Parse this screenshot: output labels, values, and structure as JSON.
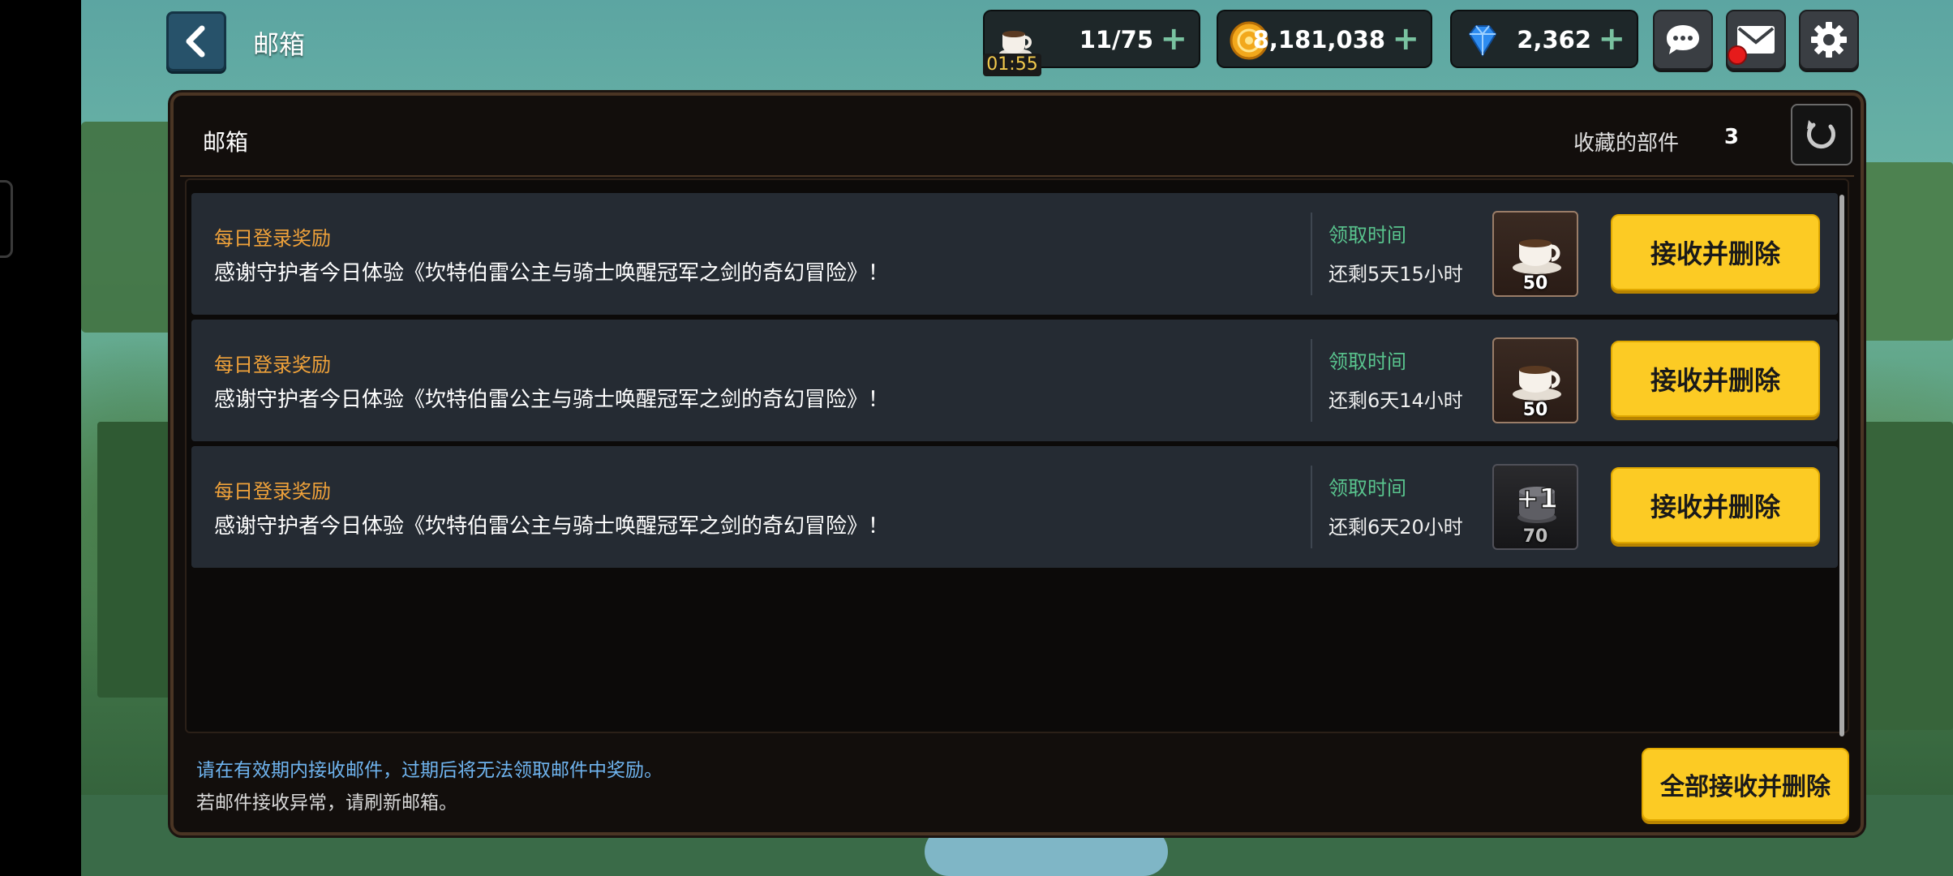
{
  "topbar": {
    "title": "邮箱",
    "stamina": {
      "value": "11/75",
      "timer": "01:55",
      "icon": "coffee-cup-icon"
    },
    "gold": {
      "value": "8,181,038",
      "icon": "gold-coin-icon"
    },
    "gems": {
      "value": "2,362",
      "icon": "diamond-icon"
    },
    "add_symbol": "+"
  },
  "panel": {
    "title": "邮箱",
    "favorites_label": "收藏的部件",
    "favorites_count": "3"
  },
  "mails": [
    {
      "category": "每日登录奖励",
      "text": "感谢守护者今日体验《坎特伯雷公主与骑士唤醒冠军之剑的奇幻冒险》！",
      "claim_label": "领取时间",
      "remaining": "还剩5天15小时",
      "item_icon": "coffee-cup-icon",
      "item_qty": "50",
      "button": "接收并删除"
    },
    {
      "category": "每日登录奖励",
      "text": "感谢守护者今日体验《坎特伯雷公主与骑士唤醒冠军之剑的奇幻冒险》！",
      "claim_label": "领取时间",
      "remaining": "还剩6天14小时",
      "item_icon": "coffee-cup-icon",
      "item_qty": "50",
      "button": "接收并删除"
    },
    {
      "category": "每日登录奖励",
      "text": "感谢守护者今日体验《坎特伯雷公主与骑士唤醒冠军之剑的奇幻冒险》！",
      "claim_label": "领取时间",
      "remaining": "还剩6天20小时",
      "item_icon": "plus-one-pot-icon",
      "item_qty": "70",
      "button": "接收并删除"
    }
  ],
  "footer": {
    "note1": "请在有效期内接收邮件，过期后将无法领取邮件中奖励。",
    "note2": "若邮件接收异常，请刷新邮箱。",
    "claim_all": "全部接收并删除"
  },
  "colors": {
    "accent_yellow": "#fccb24",
    "category_orange": "#f0a23a",
    "claim_green": "#59c48e",
    "note_blue": "#6fb4ef"
  }
}
